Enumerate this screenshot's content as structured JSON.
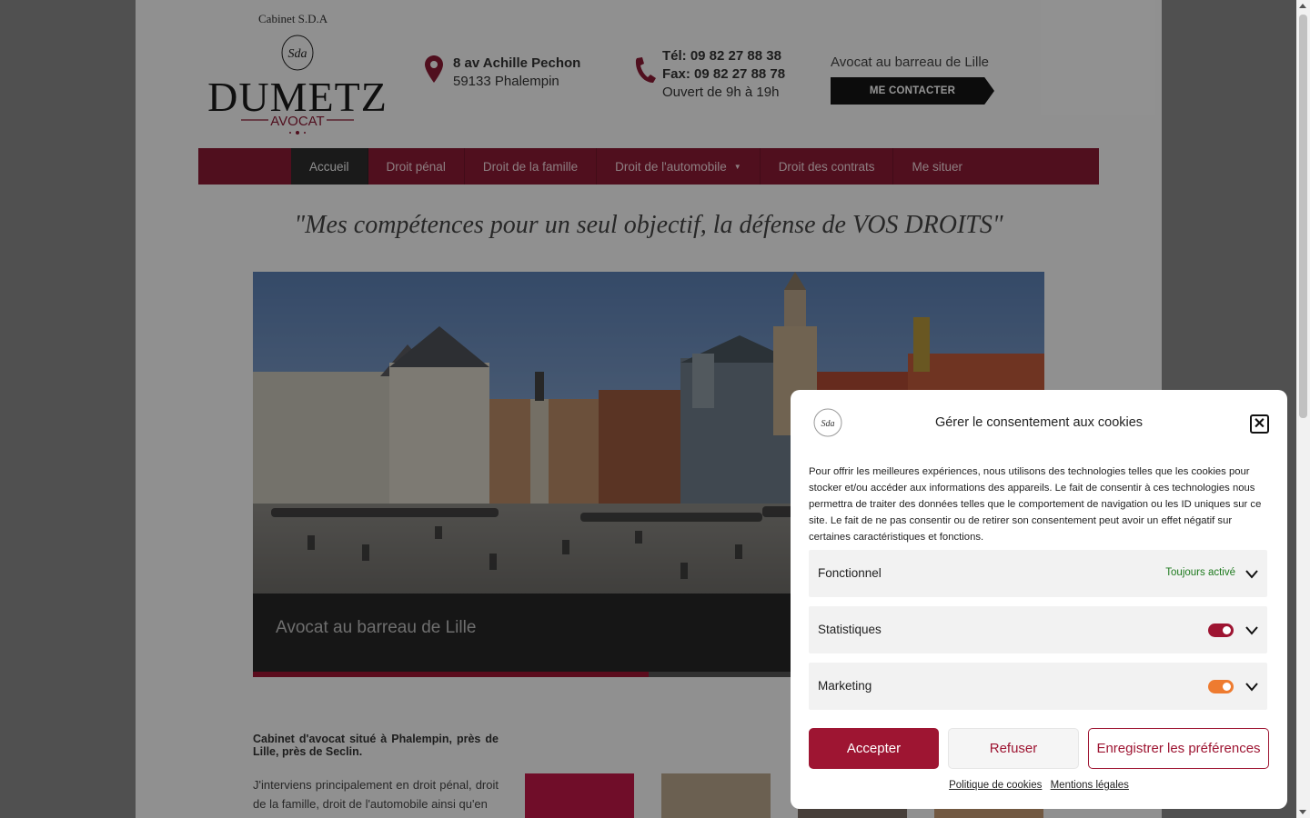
{
  "colors": {
    "brand": "#8b1a34",
    "accent": "#9e1532",
    "toggle_statistiques": "#9e1532",
    "toggle_marketing": "#ee7b30",
    "always_active": "#1e7a1e"
  },
  "header": {
    "brand_top": "Cabinet S.D.A",
    "logo": {
      "monogram": "Sda",
      "name": "DUMETZ",
      "subtitle": "AVOCAT"
    },
    "address": {
      "icon": "map-pin-icon",
      "line1": "8 av Achille Pechon",
      "line2": "59133 Phalempin"
    },
    "contact": {
      "icon": "phone-icon",
      "tel": "Tél: 09 82 27 88 38",
      "fax": "Fax: 09 82 27 88 78",
      "hours": "Ouvert de 9h à 19h"
    },
    "barreau": "Avocat au barreau de Lille",
    "contact_button": "ME CONTACTER"
  },
  "nav": {
    "items": [
      {
        "label": "Accueil",
        "active": true
      },
      {
        "label": "Droit pénal"
      },
      {
        "label": "Droit de la famille"
      },
      {
        "label": "Droit de l'automobile",
        "has_dropdown": true
      },
      {
        "label": "Droit des contrats"
      },
      {
        "label": "Me situer"
      }
    ]
  },
  "slogan": "\"Mes compétences pour un seul objectif, la défense de VOS DROITS\"",
  "slider": {
    "caption": "Avocat au barreau de Lille",
    "progress": 0.5
  },
  "intro": {
    "bold": "Cabinet d'avocat situé à Phalempin, près de Lille, près de Seclin.",
    "paragraph": "J'interviens principalement en droit pénal, droit de la famille, droit de l'automobile ainsi qu'en"
  },
  "cookie_modal": {
    "title": "Gérer le consentement aux cookies",
    "text": "Pour offrir les meilleures expériences, nous utilisons des technologies telles que les cookies pour stocker et/ou accéder aux informations des appareils. Le fait de consentir à ces technologies nous permettra de traiter des données telles que le comportement de navigation ou les ID uniques sur ce site. Le fait de ne pas consentir ou de retirer son consentement peut avoir un effet négatif sur certaines caractéristiques et fonctions.",
    "categories": [
      {
        "label": "Fonctionnel",
        "status": "Toujours activé"
      },
      {
        "label": "Statistiques",
        "enabled": true
      },
      {
        "label": "Marketing",
        "enabled": true
      }
    ],
    "buttons": {
      "accept": "Accepter",
      "refuse": "Refuser",
      "preferences": "Enregistrer les préférences"
    },
    "links": {
      "cookie_policy": "Politique de cookies",
      "legal": "Mentions légales"
    }
  }
}
